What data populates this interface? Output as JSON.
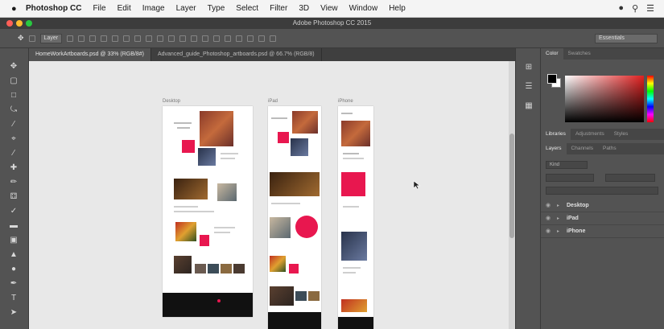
{
  "menubar": {
    "app": "Photoshop CC",
    "items": [
      "File",
      "Edit",
      "Image",
      "Layer",
      "Type",
      "Select",
      "Filter",
      "3D",
      "View",
      "Window",
      "Help"
    ]
  },
  "window": {
    "title": "Adobe Photoshop CC 2015"
  },
  "options": {
    "layer_select": "Layer",
    "workspace": "Essentials"
  },
  "tabs": [
    {
      "label": "HomeWorkArtboards.psd @ 33% (RGB/8#)"
    },
    {
      "label": "Advanced_guide_Photoshop_artboards.psd @ 66.7% (RGB/8)"
    }
  ],
  "artboards": [
    {
      "label": "Desktop"
    },
    {
      "label": "iPad"
    },
    {
      "label": "iPhone"
    }
  ],
  "color_panel": {
    "tabs": [
      "Color",
      "Swatches"
    ],
    "accent": "#e8174f"
  },
  "library_tabs": [
    "Libraries",
    "Adjustments",
    "Styles"
  ],
  "layers_panel": {
    "tabs": [
      "Layers",
      "Channels",
      "Paths"
    ],
    "filter": "Kind",
    "layers": [
      "Desktop",
      "iPad",
      "iPhone"
    ]
  }
}
